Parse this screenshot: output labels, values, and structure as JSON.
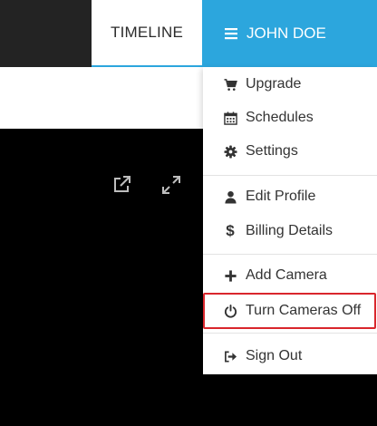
{
  "header": {
    "timeline_tab": "TIMELINE",
    "user_menu_label": "JOHN DOE",
    "user_menu_icon": "hamburger-icon"
  },
  "video_controls": [
    {
      "name": "popout",
      "icon": "external-link-icon"
    },
    {
      "name": "fullscreen",
      "icon": "expand-icon"
    }
  ],
  "dropdown": {
    "items": [
      {
        "label": "Upgrade",
        "icon": "cart-icon"
      },
      {
        "label": "Schedules",
        "icon": "calendar-icon"
      },
      {
        "label": "Settings",
        "icon": "gear-icon"
      },
      {
        "label": "Edit Profile",
        "icon": "user-icon"
      },
      {
        "label": "Billing Details",
        "icon": "dollar-icon"
      },
      {
        "label": "Add Camera",
        "icon": "plus-icon"
      },
      {
        "label": "Turn Cameras Off",
        "icon": "power-icon",
        "highlighted": true
      },
      {
        "label": "Sign Out",
        "icon": "sign-out-icon"
      }
    ]
  },
  "colors": {
    "accent": "#2ca6dd",
    "header_dark": "#232323",
    "highlight_border": "#d9262c",
    "video_background": "#000000"
  }
}
